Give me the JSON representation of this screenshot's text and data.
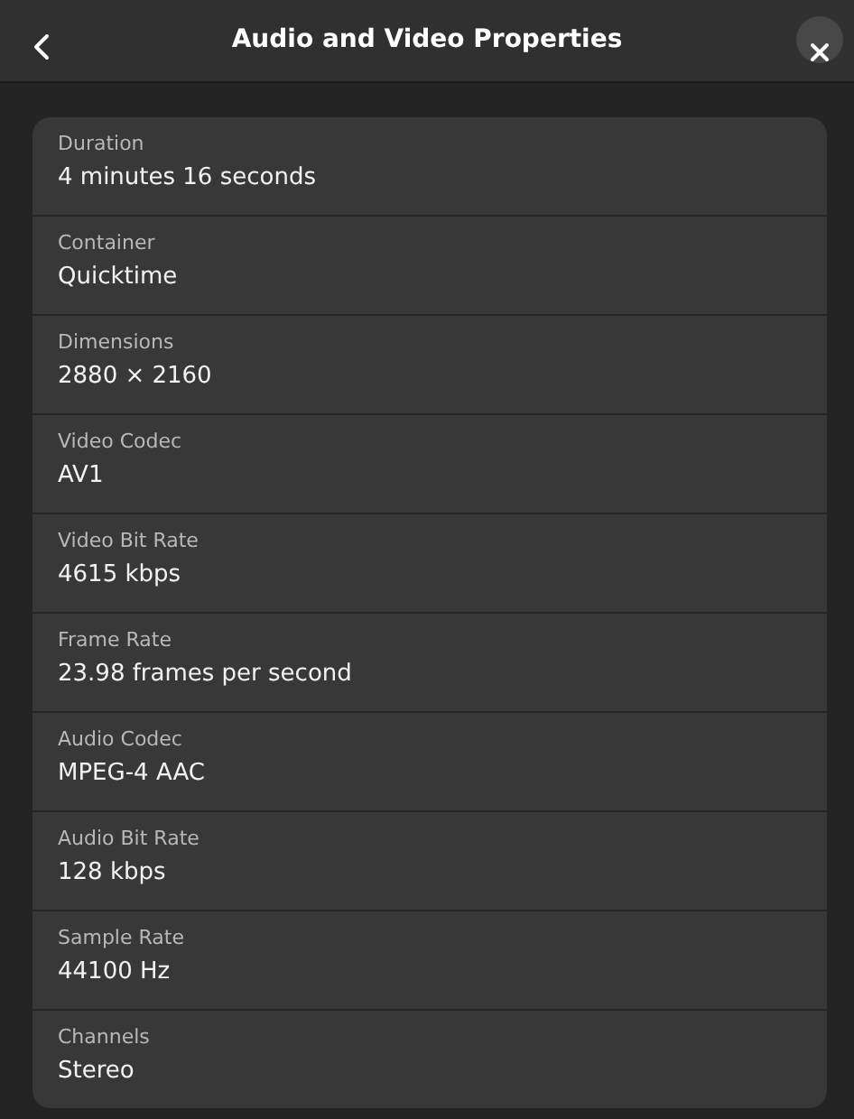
{
  "window": {
    "title": "Audio and Video Properties"
  },
  "properties": [
    {
      "label": "Duration",
      "value": "4 minutes 16 seconds"
    },
    {
      "label": "Container",
      "value": "Quicktime"
    },
    {
      "label": "Dimensions",
      "value": "2880 × 2160"
    },
    {
      "label": "Video Codec",
      "value": "AV1"
    },
    {
      "label": "Video Bit Rate",
      "value": "4615 kbps"
    },
    {
      "label": "Frame Rate",
      "value": "23.98 frames per second"
    },
    {
      "label": "Audio Codec",
      "value": "MPEG-4 AAC"
    },
    {
      "label": "Audio Bit Rate",
      "value": "128 kbps"
    },
    {
      "label": "Sample Rate",
      "value": "44100 Hz"
    },
    {
      "label": "Channels",
      "value": "Stereo"
    }
  ]
}
